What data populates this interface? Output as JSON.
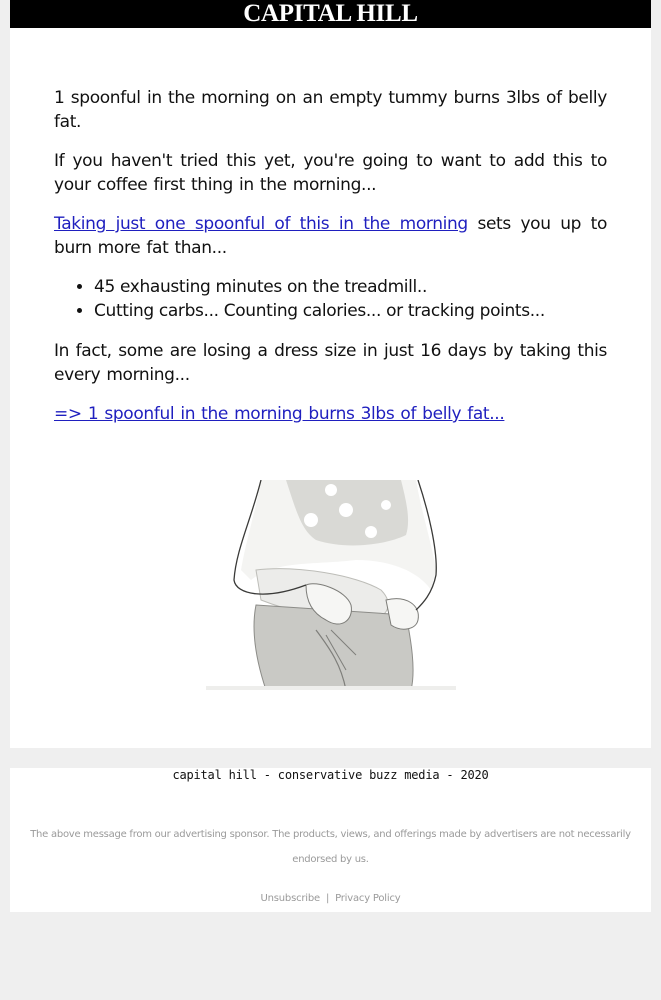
{
  "header": {
    "title": "CAPITAL HILL"
  },
  "article": {
    "paragraph1": "1 spoonful in the morning on an empty tummy burns 3lbs of belly fat.",
    "paragraph2": "If you haven't tried this yet, you're going to want to add this to your coffee first thing in the morning...",
    "paragraph3_link": "Taking just one spoonful of this in the morning",
    "paragraph3_rest": " sets you up to burn more fat than...",
    "bullets": [
      "45 exhausting minutes on the treadmill..",
      "Cutting carbs... Counting calories... or tracking points..."
    ],
    "paragraph4": "In fact, some are losing a dress size in just 16 days by taking this every morning...",
    "cta_link": "=> 1 spoonful in the morning burns 3lbs of belly fat...",
    "link_color": "#1f1fbf"
  },
  "hero_image": {
    "alt": "illustration of woman pinching belly fat above jeans"
  },
  "footer": {
    "brand_line": "capital hill - conservative buzz media - 2020",
    "disclaimer": "The above message from our advertising sponsor. The products, views, and offerings made by advertisers are not necessarily endorsed by us.",
    "unsubscribe": "Unsubscribe",
    "separator": "|",
    "privacy_policy": "Privacy Policy"
  }
}
